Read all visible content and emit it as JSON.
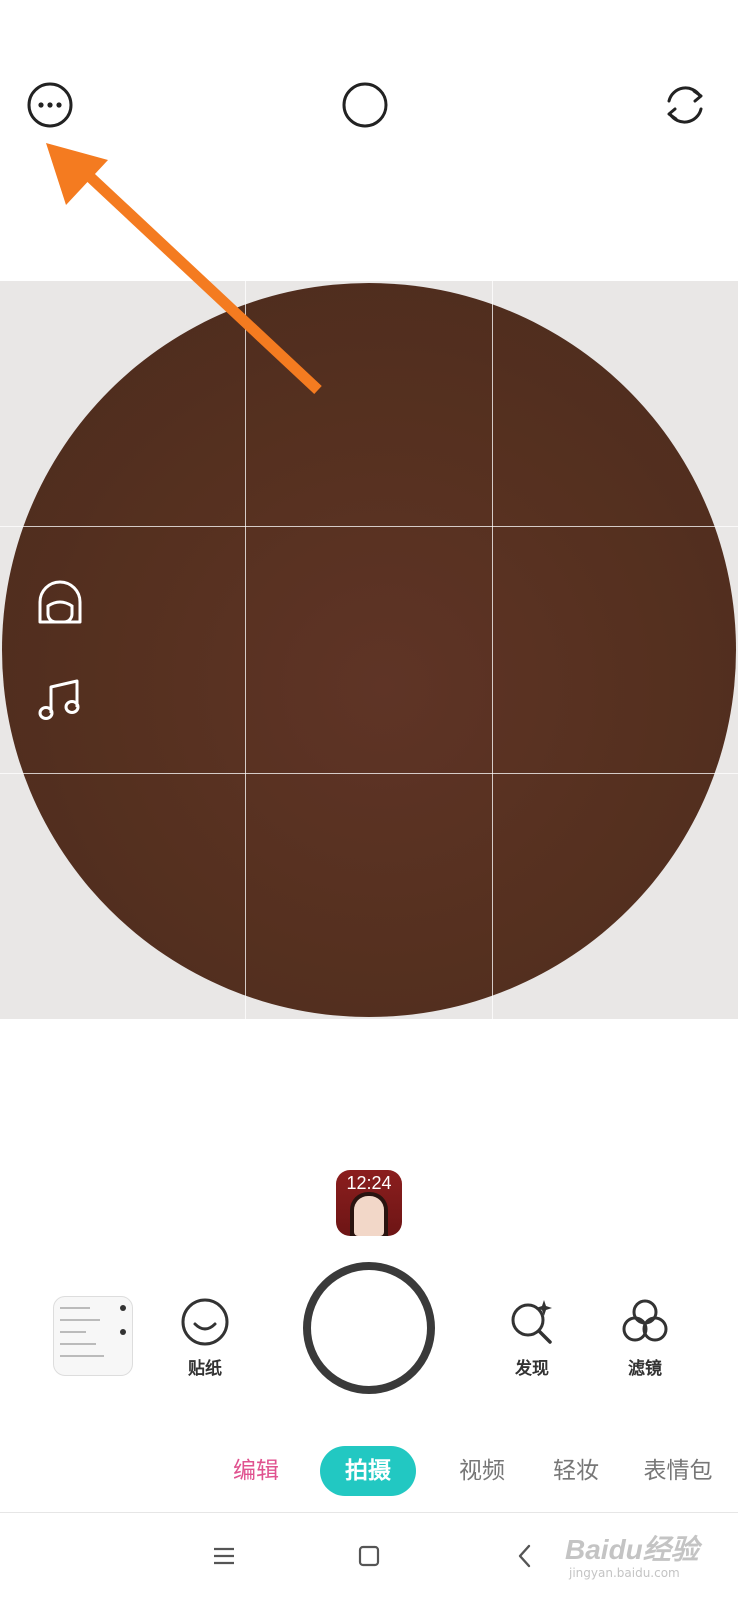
{
  "top_bar": {
    "icons": [
      "more-horizontal-icon",
      "circle-mode-icon",
      "switch-camera-icon"
    ]
  },
  "viewfinder": {
    "grid": "3x3",
    "side_icons": [
      "face-shape-icon",
      "music-note-icon"
    ]
  },
  "recent_photo": {
    "time_text": "12:24"
  },
  "controls": {
    "sticker_label": "贴纸",
    "discover_label": "发现",
    "filter_label": "滤镜"
  },
  "modes": {
    "edit": "编辑",
    "shoot": "拍摄",
    "video": "视频",
    "light_makeup": "轻妆",
    "emoji": "表情包",
    "active": "拍摄"
  },
  "watermark": {
    "main": "Baidu经验",
    "sub": "jingyan.baidu.com"
  },
  "colors": {
    "accent_teal": "#22c8c2",
    "edit_pink": "#e0528f",
    "annotation_arrow": "#f47b20",
    "lens_brown": "#55301f"
  }
}
